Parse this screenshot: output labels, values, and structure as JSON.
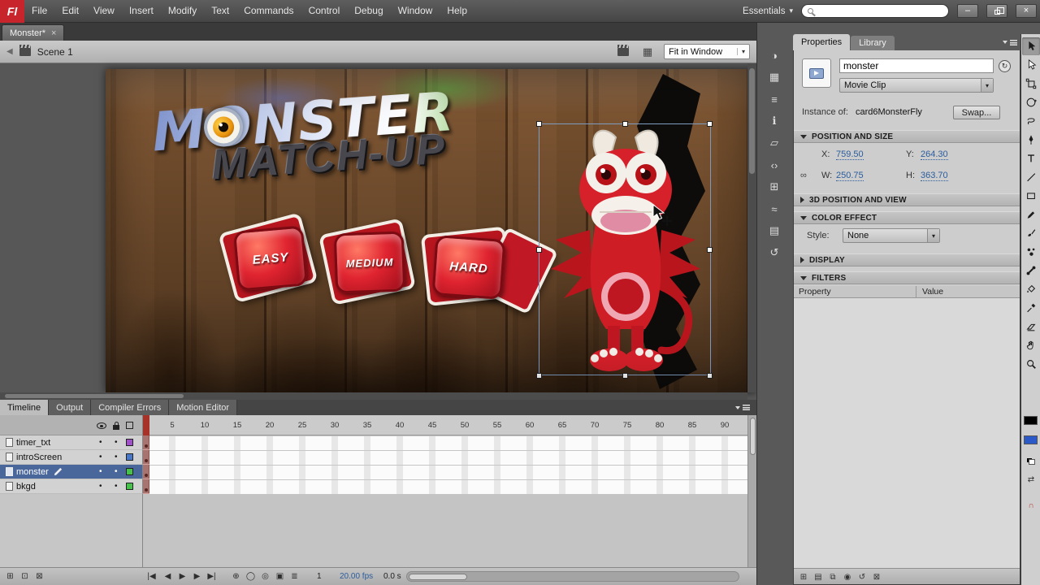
{
  "colors": {
    "accent_selection_blue": "#7d9cc0",
    "selected_layer_blue": "#4a679b",
    "hot_text_blue": "#2c5d9d",
    "playhead_red": "#a63228",
    "fill_chip_blue": "#2b59c8",
    "flash_logo_red": "#c8242b",
    "stage_button_red": "#cf1d28",
    "logo_green": "#55b244"
  },
  "menu_bar": {
    "logo_text": "Fl",
    "items": [
      "File",
      "Edit",
      "View",
      "Insert",
      "Modify",
      "Text",
      "Commands",
      "Control",
      "Debug",
      "Window",
      "Help"
    ],
    "workspace_switcher": "Essentials",
    "search_value": ""
  },
  "window_controls": {
    "minimize_glyph": "–",
    "close_glyph": "×"
  },
  "document_tab": {
    "title": "Monster*",
    "close_glyph": "×"
  },
  "edit_bar": {
    "scene_name": "Scene 1",
    "zoom_selector_value": "Fit in Window"
  },
  "stage": {
    "logo_line1": "MONSTER",
    "logo_line2": "MATCH-UP",
    "difficulty_buttons": [
      "EASY",
      "MEDIUM",
      "HARD"
    ]
  },
  "properties_panel": {
    "tabs": [
      "Properties",
      "Library"
    ],
    "instance_name_value": "monster",
    "symbol_behavior_value": "Movie Clip",
    "instance_of_label": "Instance of:",
    "instance_of_value": "card6MonsterFly",
    "swap_button_label": "Swap...",
    "position_section": {
      "title": "POSITION AND SIZE",
      "x_label": "X:",
      "x_value": "759.50",
      "y_label": "Y:",
      "y_value": "264.30",
      "w_label": "W:",
      "w_value": "250.75",
      "h_label": "H:",
      "h_value": "363.70"
    },
    "three_d_section_title": "3D POSITION AND VIEW",
    "color_effect_section": {
      "title": "COLOR EFFECT",
      "style_label": "Style:",
      "style_value": "None"
    },
    "display_section_title": "DISPLAY",
    "filters_section": {
      "title": "FILTERS",
      "property_column_header": "Property",
      "value_column_header": "Value"
    }
  },
  "timeline_panel": {
    "tabs": [
      "Timeline",
      "Output",
      "Compiler Errors",
      "Motion Editor"
    ],
    "layers": [
      {
        "name": "timer_txt",
        "outline_color": "#a050c8"
      },
      {
        "name": "introScreen",
        "outline_color": "#4a78c8"
      },
      {
        "name": "monster",
        "outline_color": "#46c24a"
      },
      {
        "name": "bkgd",
        "outline_color": "#46c24a"
      }
    ],
    "ruler_ticks": [
      "5",
      "10",
      "15",
      "20",
      "25",
      "30",
      "35",
      "40",
      "45",
      "50",
      "55",
      "60",
      "65",
      "70",
      "75",
      "80",
      "85",
      "90"
    ],
    "current_frame": "1",
    "frame_rate": "20.00 fps",
    "elapsed_time": "0.0 s"
  },
  "icons": {
    "back_glyph": "◀",
    "workspace_arrow_glyph": "▾",
    "dropdown_arrow_glyph": "▾",
    "edit_scene_name": "edit-scene-icon",
    "edit_symbols_glyph": "▦",
    "instance_edit_glyph": "↻",
    "new_layer_glyph": "⊞",
    "new_folder_glyph": "⊡",
    "delete_layer_glyph": "⊠",
    "first_frame_glyph": "|◀",
    "step_back_glyph": "◀",
    "play_glyph": "▶",
    "step_forward_glyph": "▶",
    "last_frame_glyph": "▶|",
    "center_frame_glyph": "⊕",
    "onion_skin_glyph": "◯",
    "onion_outlines_glyph": "◎",
    "edit_multiple_frames_glyph": "▣",
    "modify_markers_glyph": "≣",
    "filters_add_glyph": "⊞",
    "filters_presets_glyph": "▤",
    "filters_clipboard_glyph": "⧉",
    "filters_enable_glyph": "◉",
    "filters_reset_glyph": "↺",
    "filters_delete_glyph": "⊠",
    "swap_colors_glyph": "⇄",
    "snap_magnet_glyph": "∩"
  },
  "dock_panels": {
    "items": [
      {
        "name": "color-panel",
        "glyph": "◑"
      },
      {
        "name": "swatches-panel",
        "glyph": "▦"
      },
      {
        "name": "align-panel",
        "glyph": "≡"
      },
      {
        "name": "info-panel",
        "glyph": "ℹ"
      },
      {
        "name": "transform-panel",
        "glyph": "▱"
      },
      {
        "name": "code-snippets-panel",
        "glyph": "‹›"
      },
      {
        "name": "components-panel",
        "glyph": "⊞"
      },
      {
        "name": "motion-presets-panel",
        "glyph": "≈"
      },
      {
        "name": "project-panel",
        "glyph": "▤"
      },
      {
        "name": "history-panel",
        "glyph": "↺"
      }
    ]
  },
  "tools": {
    "names": [
      "Selection",
      "Subselection",
      "Free Transform",
      "3D Rotation",
      "Lasso",
      "Pen",
      "Text",
      "Line",
      "Rectangle",
      "Pencil",
      "Brush",
      "Deco",
      "Bone",
      "Paint Bucket",
      "Eyedropper",
      "Eraser",
      "Hand",
      "Zoom"
    ]
  }
}
